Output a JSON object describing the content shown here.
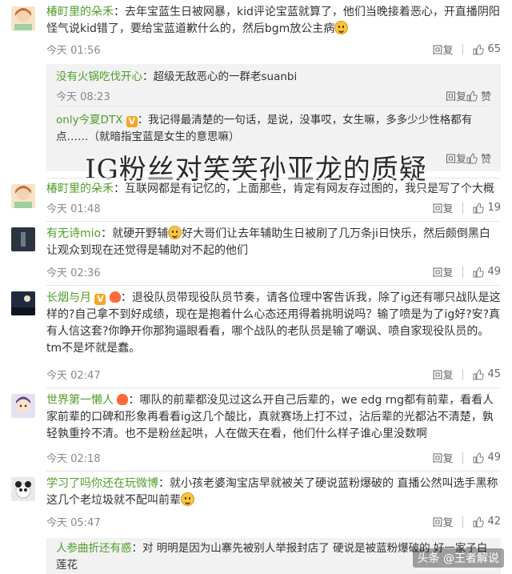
{
  "overlay_title": "IG粉丝对笑笑孙亚龙的质疑",
  "watermark": "头条 @王者解说",
  "reply_label": "回复",
  "like_label": "赞",
  "comments": [
    {
      "user": "椿町里的朵禾",
      "text": "：去年宝蓝生日被网暴，kid评论宝蓝就算了，他们当晚接着恶心，开直播阴阳怪气说kid错了，要给宝蓝道歉什么的，然后bgm放公主病",
      "time": "今天 01:56",
      "likes": "65",
      "replies": [
        {
          "user": "没有火锅吃伐开心",
          "text": "：超级无敌恶心的一群老suanbi",
          "time": "今天 08:23",
          "like": "赞"
        },
        {
          "user": "only今夏DTX",
          "text": "：我记得最清楚的一句话，是说，没事哎，女生嘛，多多少少性格都有点……（就暗指宝蓝是女生的意思嘛）",
          "time": "",
          "like": "赞"
        }
      ]
    },
    {
      "user": "椿町里的朵禾",
      "text": "：互联网都是有记忆的，上面那些，肯定有网友存过图的，我只是写了个大概",
      "time": "今天 01:48",
      "likes": "19"
    },
    {
      "user": "有无诗mio",
      "text_a": "：就硬开野辅",
      "text_b": "好大哥们让去年辅助生日被刷了几万条ji日快乐，然后颇倒黑白让观众到现在还觉得是辅助对不起的他们",
      "time": "今天 02:36",
      "likes": "49"
    },
    {
      "user": "长烟与月",
      "text": "：退役队员带现役队员节奏，请各位理中客告诉我，除了ig还有哪只战队是这样的?自己拿不到好成绩，现在是抱着什么心态还用得着挑明说吗？输了喷是为了ig好?安?真有人信这套?你睁开你那狗逼眼看看，哪个战队的老队员是输了嘲讽、喷自家现役队员的。tm不是坏就是蠢。",
      "time": "今天 02:47",
      "likes": "45"
    },
    {
      "user": "世界第一懒人",
      "text": "：哪队的前辈都没见过这么开自己后辈的，we edg rng都有前辈，看看人家前辈的口碑和形象再看看ig这几个酸比，真就赛场上打不过，沾后辈的光都沾不清楚，孰轻孰重拎不清。也不是粉丝起哄，人在做天在看，他们什么样子谁心里没数啊",
      "time": "今天 02:18",
      "likes": "49"
    },
    {
      "user": "学习了吗你还在玩微博",
      "text": "：就小孩老婆淘宝店早就被关了硬说蓝粉爆破的 直播公然叫选手黑称这几个老垃圾就不配叫前辈",
      "time": "今天 05:47",
      "likes": "42",
      "replies": [
        {
          "user": "人参曲折还有惑",
          "text": "：对 明明是因为山寨先被别人举报封店了 硬说是被蓝粉爆破的 好一家子白莲花"
        }
      ]
    }
  ],
  "colors": {
    "username": "#4f9e29",
    "reply_bg": "#f2f2f2",
    "badge": "#f5a623"
  }
}
